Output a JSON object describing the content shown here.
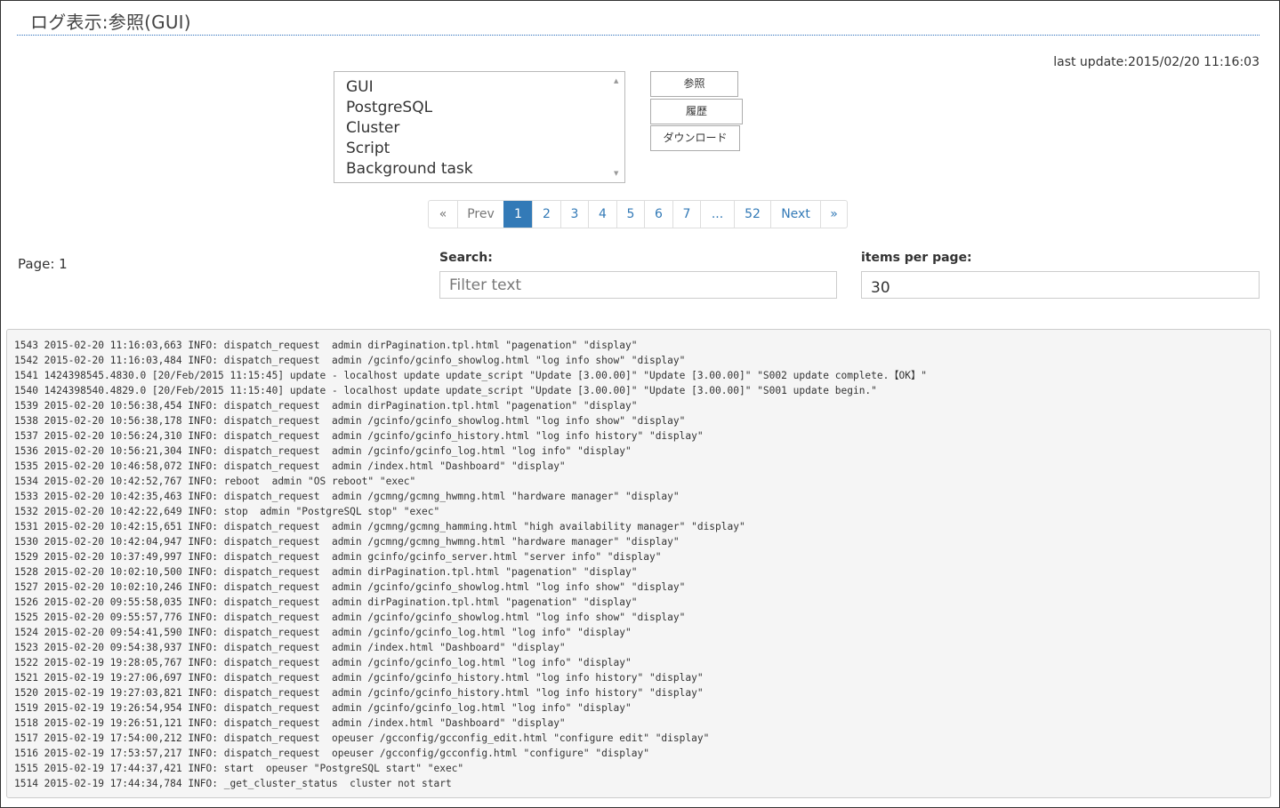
{
  "page": {
    "title": "ログ表示:参照(GUI)",
    "last_update": "last update:2015/02/20 11:16:03"
  },
  "log_types": [
    "GUI",
    "PostgreSQL",
    "Cluster",
    "Script",
    "Background task"
  ],
  "buttons": {
    "reference": "参照",
    "history": "履歴",
    "download": "ダウンロード"
  },
  "pagination": [
    "«",
    "Prev",
    "1",
    "2",
    "3",
    "4",
    "5",
    "6",
    "7",
    "...",
    "52",
    "Next",
    "»"
  ],
  "pagination_active": "1",
  "page_label": "Page: 1",
  "search": {
    "label": "Search:",
    "placeholder": "Filter text",
    "value": ""
  },
  "items_per_page": {
    "label": "items per page:",
    "value": "30"
  },
  "log_lines": [
    "1543 2015-02-20 11:16:03,663 INFO: dispatch_request  admin dirPagination.tpl.html \"pagenation\" \"display\"",
    "1542 2015-02-20 11:16:03,484 INFO: dispatch_request  admin /gcinfo/gcinfo_showlog.html \"log info show\" \"display\"",
    "1541 1424398545.4830.0 [20/Feb/2015 11:15:45] update - localhost update update_script \"Update [3.00.00]\" \"Update [3.00.00]\" \"S002 update complete.【OK】\"",
    "1540 1424398540.4829.0 [20/Feb/2015 11:15:40] update - localhost update update_script \"Update [3.00.00]\" \"Update [3.00.00]\" \"S001 update begin.\"",
    "1539 2015-02-20 10:56:38,454 INFO: dispatch_request  admin dirPagination.tpl.html \"pagenation\" \"display\"",
    "1538 2015-02-20 10:56:38,178 INFO: dispatch_request  admin /gcinfo/gcinfo_showlog.html \"log info show\" \"display\"",
    "1537 2015-02-20 10:56:24,310 INFO: dispatch_request  admin /gcinfo/gcinfo_history.html \"log info history\" \"display\"",
    "1536 2015-02-20 10:56:21,304 INFO: dispatch_request  admin /gcinfo/gcinfo_log.html \"log info\" \"display\"",
    "1535 2015-02-20 10:46:58,072 INFO: dispatch_request  admin /index.html \"Dashboard\" \"display\"",
    "1534 2015-02-20 10:42:52,767 INFO: reboot  admin \"OS reboot\" \"exec\"",
    "1533 2015-02-20 10:42:35,463 INFO: dispatch_request  admin /gcmng/gcmng_hwmng.html \"hardware manager\" \"display\"",
    "1532 2015-02-20 10:42:22,649 INFO: stop  admin \"PostgreSQL stop\" \"exec\"",
    "1531 2015-02-20 10:42:15,651 INFO: dispatch_request  admin /gcmng/gcmng_hamming.html \"high availability manager\" \"display\"",
    "1530 2015-02-20 10:42:04,947 INFO: dispatch_request  admin /gcmng/gcmng_hwmng.html \"hardware manager\" \"display\"",
    "1529 2015-02-20 10:37:49,997 INFO: dispatch_request  admin gcinfo/gcinfo_server.html \"server info\" \"display\"",
    "1528 2015-02-20 10:02:10,500 INFO: dispatch_request  admin dirPagination.tpl.html \"pagenation\" \"display\"",
    "1527 2015-02-20 10:02:10,246 INFO: dispatch_request  admin /gcinfo/gcinfo_showlog.html \"log info show\" \"display\"",
    "1526 2015-02-20 09:55:58,035 INFO: dispatch_request  admin dirPagination.tpl.html \"pagenation\" \"display\"",
    "1525 2015-02-20 09:55:57,776 INFO: dispatch_request  admin /gcinfo/gcinfo_showlog.html \"log info show\" \"display\"",
    "1524 2015-02-20 09:54:41,590 INFO: dispatch_request  admin /gcinfo/gcinfo_log.html \"log info\" \"display\"",
    "1523 2015-02-20 09:54:38,937 INFO: dispatch_request  admin /index.html \"Dashboard\" \"display\"",
    "1522 2015-02-19 19:28:05,767 INFO: dispatch_request  admin /gcinfo/gcinfo_log.html \"log info\" \"display\"",
    "1521 2015-02-19 19:27:06,697 INFO: dispatch_request  admin /gcinfo/gcinfo_history.html \"log info history\" \"display\"",
    "1520 2015-02-19 19:27:03,821 INFO: dispatch_request  admin /gcinfo/gcinfo_history.html \"log info history\" \"display\"",
    "1519 2015-02-19 19:26:54,954 INFO: dispatch_request  admin /gcinfo/gcinfo_log.html \"log info\" \"display\"",
    "1518 2015-02-19 19:26:51,121 INFO: dispatch_request  admin /index.html \"Dashboard\" \"display\"",
    "1517 2015-02-19 17:54:00,212 INFO: dispatch_request  opeuser /gcconfig/gcconfig_edit.html \"configure edit\" \"display\"",
    "1516 2015-02-19 17:53:57,217 INFO: dispatch_request  opeuser /gcconfig/gcconfig.html \"configure\" \"display\"",
    "1515 2015-02-19 17:44:37,421 INFO: start  opeuser \"PostgreSQL start\" \"exec\"",
    "1514 2015-02-19 17:44:34,784 INFO: _get_cluster_status  cluster not start"
  ]
}
